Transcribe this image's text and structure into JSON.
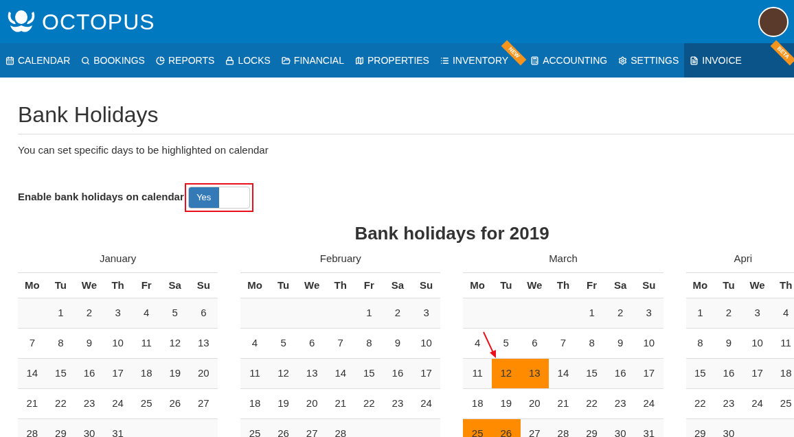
{
  "header": {
    "brand": "OCTOPUS"
  },
  "nav": [
    {
      "label": "CALENDAR",
      "selected": false
    },
    {
      "label": "BOOKINGS",
      "selected": false
    },
    {
      "label": "REPORTS",
      "selected": false
    },
    {
      "label": "LOCKS",
      "selected": false
    },
    {
      "label": "FINANCIAL",
      "selected": false
    },
    {
      "label": "PROPERTIES",
      "selected": false
    },
    {
      "label": "INVENTORY",
      "selected": false,
      "ribbon": "NEW"
    },
    {
      "label": "ACCOUNTING",
      "selected": false
    },
    {
      "label": "SETTINGS",
      "selected": false
    },
    {
      "label": "INVOICE",
      "selected": true,
      "ribbon": "BETA"
    }
  ],
  "page": {
    "title": "Bank Holidays",
    "description": "You can set specific days to be highlighted on calendar"
  },
  "toggle": {
    "label": "Enable bank holidays on calendar",
    "on": true,
    "on_text": "Yes"
  },
  "calendar_title": "Bank holidays for 2019",
  "months": [
    {
      "name": "January",
      "weekdays": [
        "Mo",
        "Tu",
        "We",
        "Th",
        "Fr",
        "Sa",
        "Su"
      ],
      "weeks": [
        [
          {
            "day": "1",
            "holiday": false
          },
          {
            "day": "2",
            "holiday": false
          },
          {
            "day": "3",
            "holiday": false
          },
          {
            "day": "4",
            "holiday": false
          },
          {
            "day": "5",
            "holiday": false
          },
          {
            "day": "6",
            "holiday": false
          }
        ],
        [
          {
            "day": "7",
            "holiday": false
          },
          {
            "day": "8",
            "holiday": false
          },
          {
            "day": "9",
            "holiday": false
          },
          {
            "day": "10",
            "holiday": false
          },
          {
            "day": "11",
            "holiday": false
          },
          {
            "day": "12",
            "holiday": false
          },
          {
            "day": "13",
            "holiday": false
          }
        ],
        [
          {
            "day": "14",
            "holiday": false
          },
          {
            "day": "15",
            "holiday": false
          },
          {
            "day": "16",
            "holiday": false
          },
          {
            "day": "17",
            "holiday": false
          },
          {
            "day": "18",
            "holiday": false
          },
          {
            "day": "19",
            "holiday": false
          },
          {
            "day": "20",
            "holiday": false
          }
        ],
        [
          {
            "day": "21",
            "holiday": false
          },
          {
            "day": "22",
            "holiday": false
          },
          {
            "day": "23",
            "holiday": false
          },
          {
            "day": "24",
            "holiday": false
          },
          {
            "day": "25",
            "holiday": false
          },
          {
            "day": "26",
            "holiday": false
          },
          {
            "day": "27",
            "holiday": false
          }
        ],
        [
          {
            "day": "28",
            "holiday": false
          },
          {
            "day": "29",
            "holiday": false
          },
          {
            "day": "30",
            "holiday": false
          },
          {
            "day": "31",
            "holiday": false
          }
        ]
      ]
    },
    {
      "name": "February",
      "weekdays": [
        "Mo",
        "Tu",
        "We",
        "Th",
        "Fr",
        "Sa",
        "Su"
      ],
      "weeks": [
        [
          {
            "day": "1",
            "holiday": false
          },
          {
            "day": "2",
            "holiday": false
          },
          {
            "day": "3",
            "holiday": false
          }
        ],
        [
          {
            "day": "4",
            "holiday": false
          },
          {
            "day": "5",
            "holiday": false
          },
          {
            "day": "6",
            "holiday": false
          },
          {
            "day": "7",
            "holiday": false
          },
          {
            "day": "8",
            "holiday": false
          },
          {
            "day": "9",
            "holiday": false
          },
          {
            "day": "10",
            "holiday": false
          }
        ],
        [
          {
            "day": "11",
            "holiday": false
          },
          {
            "day": "12",
            "holiday": false
          },
          {
            "day": "13",
            "holiday": false
          },
          {
            "day": "14",
            "holiday": false
          },
          {
            "day": "15",
            "holiday": false
          },
          {
            "day": "16",
            "holiday": false
          },
          {
            "day": "17",
            "holiday": false
          }
        ],
        [
          {
            "day": "18",
            "holiday": false
          },
          {
            "day": "19",
            "holiday": false
          },
          {
            "day": "20",
            "holiday": false
          },
          {
            "day": "21",
            "holiday": false
          },
          {
            "day": "22",
            "holiday": false
          },
          {
            "day": "23",
            "holiday": false
          },
          {
            "day": "24",
            "holiday": false
          }
        ],
        [
          {
            "day": "25",
            "holiday": false
          },
          {
            "day": "26",
            "holiday": false
          },
          {
            "day": "27",
            "holiday": false
          },
          {
            "day": "28",
            "holiday": false
          }
        ]
      ]
    },
    {
      "name": "March",
      "weekdays": [
        "Mo",
        "Tu",
        "We",
        "Th",
        "Fr",
        "Sa",
        "Su"
      ],
      "weeks": [
        [
          {
            "day": "1",
            "holiday": false
          },
          {
            "day": "2",
            "holiday": false
          },
          {
            "day": "3",
            "holiday": false
          }
        ],
        [
          {
            "day": "4",
            "holiday": false
          },
          {
            "day": "5",
            "holiday": false
          },
          {
            "day": "6",
            "holiday": false
          },
          {
            "day": "7",
            "holiday": false
          },
          {
            "day": "8",
            "holiday": false
          },
          {
            "day": "9",
            "holiday": false
          },
          {
            "day": "10",
            "holiday": false
          }
        ],
        [
          {
            "day": "11",
            "holiday": false
          },
          {
            "day": "12",
            "holiday": true
          },
          {
            "day": "13",
            "holiday": true
          },
          {
            "day": "14",
            "holiday": false
          },
          {
            "day": "15",
            "holiday": false
          },
          {
            "day": "16",
            "holiday": false
          },
          {
            "day": "17",
            "holiday": false
          }
        ],
        [
          {
            "day": "18",
            "holiday": false
          },
          {
            "day": "19",
            "holiday": false
          },
          {
            "day": "20",
            "holiday": false
          },
          {
            "day": "21",
            "holiday": false
          },
          {
            "day": "22",
            "holiday": false
          },
          {
            "day": "23",
            "holiday": false
          },
          {
            "day": "24",
            "holiday": false
          }
        ],
        [
          {
            "day": "25",
            "holiday": true
          },
          {
            "day": "26",
            "holiday": true
          },
          {
            "day": "27",
            "holiday": false
          },
          {
            "day": "28",
            "holiday": false
          },
          {
            "day": "29",
            "holiday": false
          },
          {
            "day": "30",
            "holiday": false
          },
          {
            "day": "31",
            "holiday": false
          }
        ]
      ]
    },
    {
      "name": "Apri",
      "weekdays": [
        "Mo",
        "Tu",
        "We",
        "Th"
      ],
      "weeks": [
        [
          {
            "day": "1",
            "holiday": false
          },
          {
            "day": "2",
            "holiday": false
          },
          {
            "day": "3",
            "holiday": false
          },
          {
            "day": "4",
            "holiday": false
          }
        ],
        [
          {
            "day": "8",
            "holiday": false
          },
          {
            "day": "9",
            "holiday": false
          },
          {
            "day": "10",
            "holiday": false
          },
          {
            "day": "11",
            "holiday": false
          }
        ],
        [
          {
            "day": "15",
            "holiday": false
          },
          {
            "day": "16",
            "holiday": false
          },
          {
            "day": "17",
            "holiday": false
          },
          {
            "day": "18",
            "holiday": false
          }
        ],
        [
          {
            "day": "22",
            "holiday": false
          },
          {
            "day": "23",
            "holiday": false
          },
          {
            "day": "24",
            "holiday": false
          },
          {
            "day": "25",
            "holiday": false
          }
        ],
        [
          {
            "day": "29",
            "holiday": false
          },
          {
            "day": "30",
            "holiday": false
          }
        ]
      ]
    }
  ]
}
